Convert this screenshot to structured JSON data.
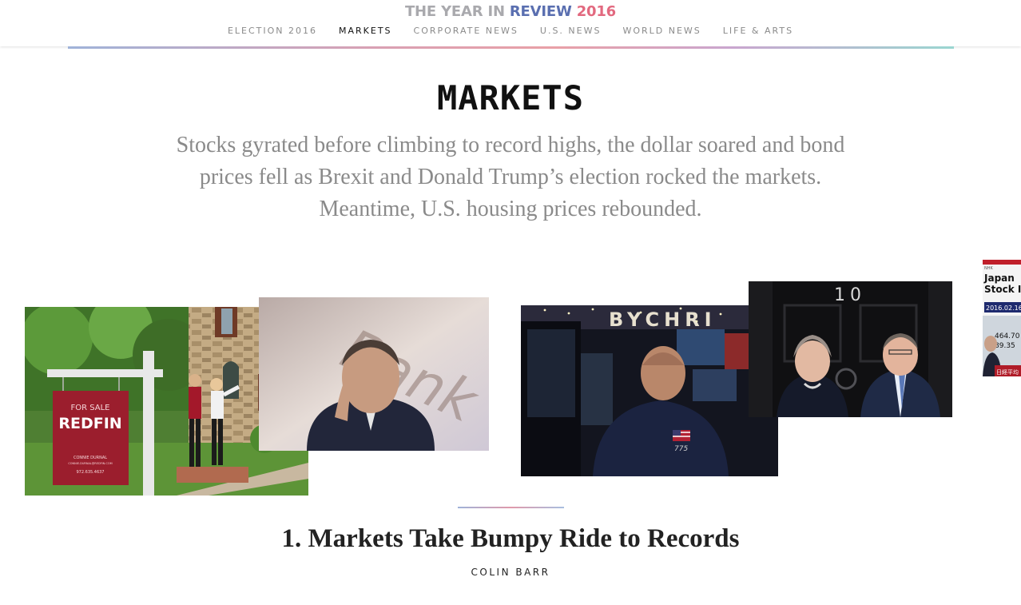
{
  "brand": {
    "part1": "THE YEAR IN ",
    "part2": "REVIEW",
    "part3": " 2016"
  },
  "nav": {
    "items": [
      "ELECTION 2016",
      "MARKETS",
      "CORPORATE NEWS",
      "U.S. NEWS",
      "WORLD NEWS",
      "LIFE & ARTS"
    ],
    "active": "MARKETS"
  },
  "section": {
    "title": "MARKETS",
    "dek": "Stocks gyrated before climbing to record highs, the dollar soared and bond prices fell as Brexit and Donald Trump’s election rocked the markets. Meantime, U.S. housing prices rebounded."
  },
  "photos": {
    "redfin_sign": {
      "top": "FOR SALE",
      "brand": "REDFIN",
      "agent": "CONNIE DURNAL",
      "site": "CONNIE.DURNAL@REDFIN.COM",
      "phone": "972.635.4637"
    },
    "banker_background_text": "Bank",
    "trader": {
      "sign_text": "BYCHRI",
      "badge": "775"
    },
    "door_number": "10",
    "japan_board": {
      "label_top": "NHK",
      "line1": "Japan",
      "line2": "Stock I",
      "date": "2016.02.16",
      "val1": "464.70",
      "val2": "89.35",
      "foot": "日経平均"
    }
  },
  "article": {
    "headline": "1. Markets Take Bumpy Ride to Records",
    "byline": "COLIN BARR"
  },
  "colors": {
    "accent_blue": "#5a6fb0",
    "accent_pink": "#e2697f",
    "redfin_red": "#9b1e2d"
  }
}
